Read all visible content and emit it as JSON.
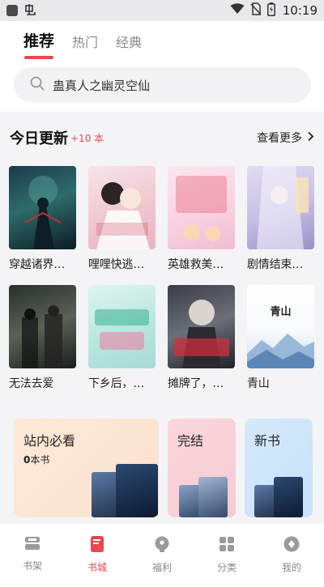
{
  "status_bar": {
    "time": "10:19",
    "left_icons": [
      "notification-square-icon",
      "app-glyph-icon"
    ],
    "right_icons": [
      "wifi-icon",
      "no-sim-icon",
      "battery-icon"
    ]
  },
  "tabs": [
    {
      "label": "推荐",
      "active": true
    },
    {
      "label": "热门",
      "active": false
    },
    {
      "label": "经典",
      "active": false
    }
  ],
  "search": {
    "text": "蛊真人之幽灵空仙"
  },
  "today": {
    "title": "今日更新",
    "badge": "+10 本",
    "more": "查看更多"
  },
  "books": [
    {
      "title": "穿越诸界…"
    },
    {
      "title": "哩哩快逃…"
    },
    {
      "title": "英雄救美…"
    },
    {
      "title": "剧情结束…"
    },
    {
      "title": "无法去爱"
    },
    {
      "title": "下乡后，…"
    },
    {
      "title": "摊牌了，…"
    },
    {
      "title": "青山"
    }
  ],
  "cover_text": {
    "book8": "青山"
  },
  "cards": [
    {
      "title": "站内必看",
      "count": "0",
      "unit": "本书"
    },
    {
      "title": "完结"
    },
    {
      "title": "新书"
    }
  ],
  "bottom_nav": [
    {
      "label": "书架",
      "icon": "bookshelf-icon",
      "active": false
    },
    {
      "label": "书城",
      "icon": "bookstore-icon",
      "active": true
    },
    {
      "label": "福利",
      "icon": "welfare-icon",
      "active": false
    },
    {
      "label": "分类",
      "icon": "category-icon",
      "active": false
    },
    {
      "label": "我的",
      "icon": "profile-icon",
      "active": false
    }
  ],
  "colors": {
    "accent": "#e9484d",
    "background": "#f4f4f6",
    "inactive": "#888888"
  }
}
